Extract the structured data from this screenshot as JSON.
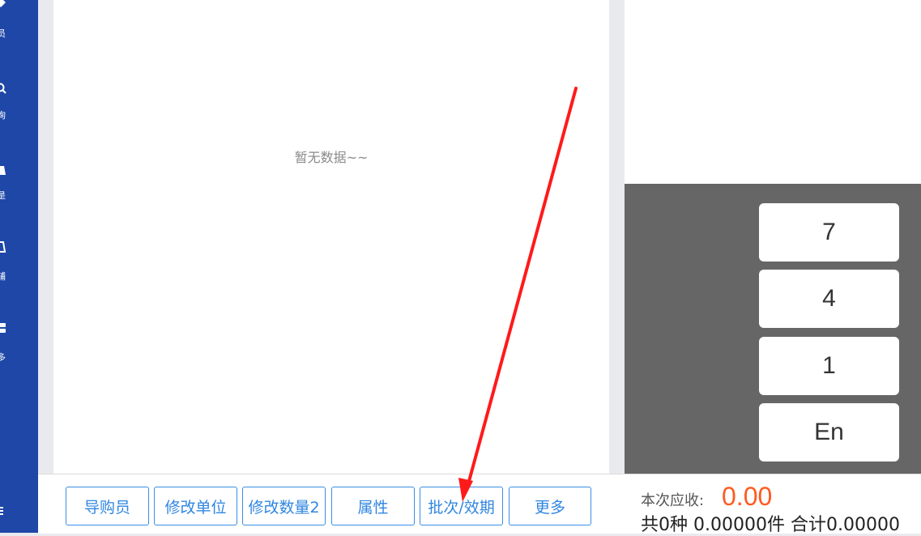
{
  "sidebar": {
    "items": [
      {
        "icon": "diamond-icon",
        "label": "员"
      },
      {
        "icon": "search-icon",
        "label": "询"
      },
      {
        "icon": "bag-icon",
        "label": "是"
      },
      {
        "icon": "cart-icon",
        "label": "铺"
      },
      {
        "icon": "grid-icon",
        "label": "多"
      },
      {
        "icon": "menu-icon",
        "label": ""
      }
    ]
  },
  "list": {
    "empty_text": "暂无数据~~"
  },
  "keypad": {
    "keys": [
      "7",
      "4",
      "1",
      "En"
    ]
  },
  "actions": {
    "guide": "导购员",
    "change_unit": "修改单位",
    "change_qty": "修改数量2",
    "attribute": "属性",
    "batch_expiry": "批次/效期",
    "more": "更多"
  },
  "summary": {
    "due_label": "本次应收:",
    "due_amount": "0.00",
    "totals_text": "共0种 0.00000件 合计0.00000"
  },
  "colors": {
    "sidebar": "#1f47a8",
    "accent": "#3a8ee6",
    "amount": "#ff5a1f",
    "annotation_arrow": "#ff1a1a"
  }
}
